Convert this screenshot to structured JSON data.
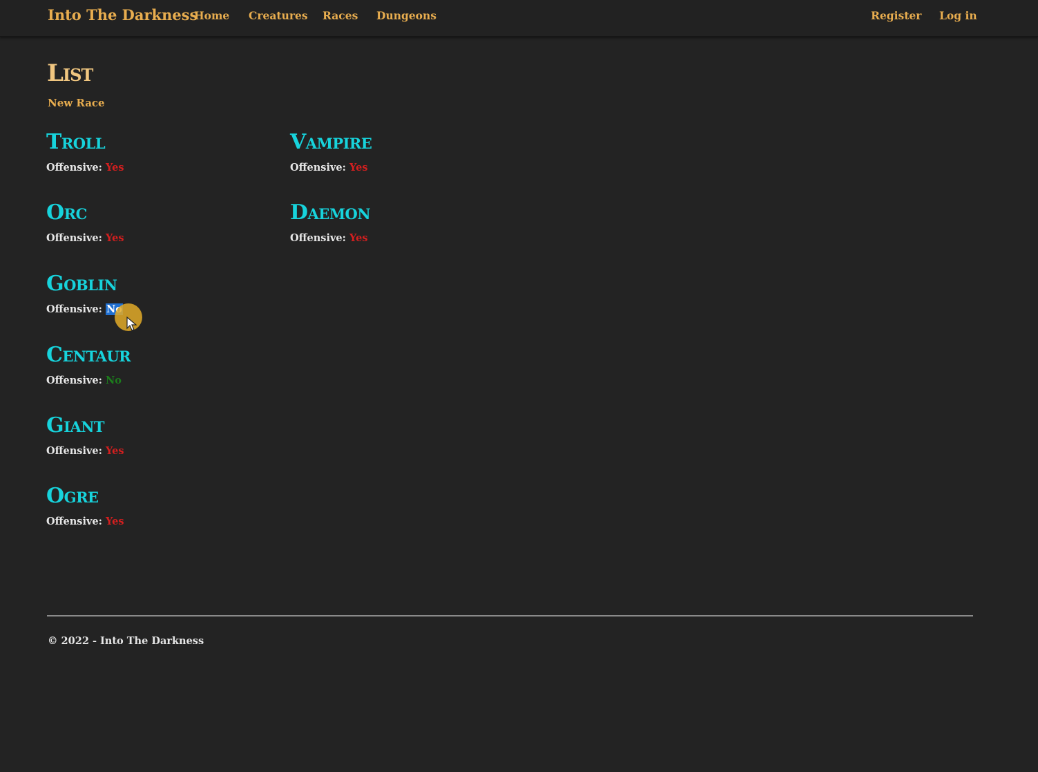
{
  "nav": {
    "brand": "Into The Darkness",
    "links": [
      "Home",
      "Creatures",
      "Races",
      "Dungeons"
    ],
    "right_links": [
      "Register",
      "Log in"
    ]
  },
  "page": {
    "title": "List",
    "new_link": "New Race"
  },
  "races": [
    {
      "name": "Troll",
      "label": "Offensive:",
      "value": "Yes"
    },
    {
      "name": "Vampire",
      "label": "Offensive:",
      "value": "Yes"
    },
    {
      "name": "Orc",
      "label": "Offensive:",
      "value": "Yes"
    },
    {
      "name": "Daemon",
      "label": "Offensive:",
      "value": "Yes"
    },
    {
      "name": "Goblin",
      "label": "Offensive:",
      "value": "No",
      "selected": true
    },
    {
      "name": "Centaur",
      "label": "Offensive:",
      "value": "No"
    },
    {
      "name": "Giant",
      "label": "Offensive:",
      "value": "Yes"
    },
    {
      "name": "Ogre",
      "label": "Offensive:",
      "value": "Yes"
    }
  ],
  "footer": {
    "text": "© 2022 - Into The Darkness"
  },
  "colors": {
    "background": "#232323",
    "accent": "#e8ad4f",
    "race_name": "#17d3dc",
    "yes": "#d41f1f",
    "no": "#1c7d1c",
    "selection": "#1f6fd0"
  }
}
